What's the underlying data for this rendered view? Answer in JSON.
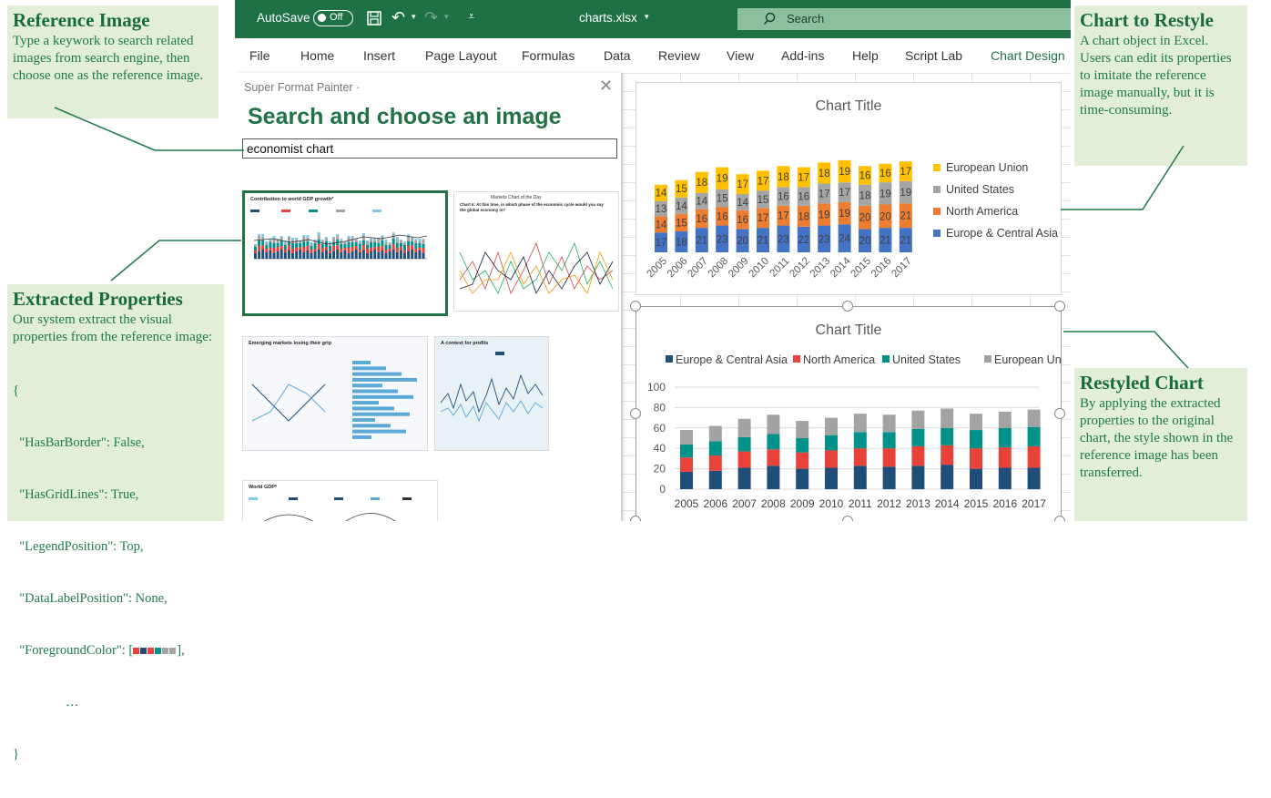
{
  "notes": {
    "reference": {
      "title": "Reference Image",
      "body": "Type a keywork to search related images from search engine, then choose one as the reference image."
    },
    "extracted": {
      "title": "Extracted Properties",
      "body": "Our system extract the visual properties from the reference image:",
      "code": [
        "{",
        "  \"HasBarBorder\": False,",
        "  \"HasGridLines\": True,",
        "  \"LegendPosition\": Top,",
        "  \"DataLabelPosition\": None,",
        "  \"ForegroundColor\": [",
        "                …",
        "}"
      ],
      "code_suffix": "],"
    },
    "restyle": {
      "title": "Chart to Restyle",
      "body": "A chart object in Excel. Users can edit its properties to imitate the reference image manually, but it is time-consuming."
    },
    "restyled": {
      "title": "Restyled Chart",
      "body": "By applying the extracted properties to the original chart, the style shown in the reference image has been transferred."
    }
  },
  "titlebar": {
    "autosave": "AutoSave",
    "toggle": "Off",
    "filename": "charts.xlsx",
    "search": "Search"
  },
  "menu": [
    "File",
    "Home",
    "Insert",
    "Page Layout",
    "Formulas",
    "Data",
    "Review",
    "View",
    "Add-ins",
    "Help",
    "Script Lab",
    "Chart Design"
  ],
  "pane": {
    "app": "Super Format Painter",
    "heading": "Search and choose an image",
    "search_value": "economist chart",
    "thumbs": [
      {
        "title": "Contribution to world GDP growth*"
      },
      {
        "title": "Chart 6: At this time, in which phase of the economic cycle would you say the global economy is?",
        "header": "Markets  Chart of the Day"
      },
      {
        "title": "Emerging markets losing their grip"
      },
      {
        "title": "A context for profits"
      },
      {
        "title": "World GDP*"
      }
    ]
  },
  "colors": {
    "accent": "#1e7145",
    "eu": "#ffc000",
    "us": "#a5a5a5",
    "na": "#ed7d31",
    "eca": "#4472c4",
    "r_eca": "#1f4e79",
    "r_na": "#e8433b",
    "r_us": "#00918a",
    "r_eu": "#a3a3a3",
    "fg_swatches": [
      "#e8433b",
      "#1f4e79",
      "#e8433b",
      "#00918a",
      "#a3a3a3",
      "#a3a3a3"
    ]
  },
  "chart_data": [
    {
      "type": "bar",
      "title": "Chart Title",
      "stacked": true,
      "categories": [
        "2005",
        "2006",
        "2007",
        "2008",
        "2009",
        "2010",
        "2011",
        "2012",
        "2013",
        "2014",
        "2015",
        "2016",
        "2017"
      ],
      "series": [
        {
          "name": "Europe & Central Asia",
          "values": [
            17,
            18,
            21,
            23,
            20,
            21,
            23,
            22,
            23,
            24,
            20,
            21,
            21
          ]
        },
        {
          "name": "North America",
          "values": [
            14,
            15,
            16,
            16,
            16,
            17,
            17,
            18,
            19,
            19,
            20,
            20,
            21
          ]
        },
        {
          "name": "United States",
          "values": [
            13,
            14,
            14,
            15,
            14,
            15,
            16,
            16,
            17,
            17,
            18,
            19,
            19
          ]
        },
        {
          "name": "European Union",
          "values": [
            14,
            15,
            18,
            19,
            17,
            17,
            18,
            17,
            18,
            19,
            16,
            16,
            17
          ]
        }
      ],
      "legend": "right",
      "data_labels": true,
      "grid": false
    },
    {
      "type": "bar",
      "title": "Chart Title",
      "stacked": true,
      "categories": [
        "2005",
        "2006",
        "2007",
        "2008",
        "2009",
        "2010",
        "2011",
        "2012",
        "2013",
        "2014",
        "2015",
        "2016",
        "2017"
      ],
      "series": [
        {
          "name": "Europe & Central Asia",
          "values": [
            17,
            18,
            21,
            23,
            20,
            21,
            23,
            22,
            23,
            24,
            20,
            21,
            21
          ]
        },
        {
          "name": "North America",
          "values": [
            14,
            15,
            16,
            16,
            16,
            17,
            17,
            18,
            19,
            19,
            20,
            20,
            21
          ]
        },
        {
          "name": "United States",
          "values": [
            13,
            14,
            14,
            15,
            14,
            15,
            16,
            16,
            17,
            17,
            18,
            19,
            19
          ]
        },
        {
          "name": "European Union",
          "values": [
            14,
            15,
            18,
            19,
            17,
            17,
            18,
            17,
            18,
            19,
            16,
            16,
            17
          ]
        }
      ],
      "legend": "top",
      "data_labels": false,
      "grid": true,
      "yticks": [
        0,
        20,
        40,
        60,
        80,
        100
      ],
      "ylim": [
        0,
        100
      ]
    }
  ]
}
